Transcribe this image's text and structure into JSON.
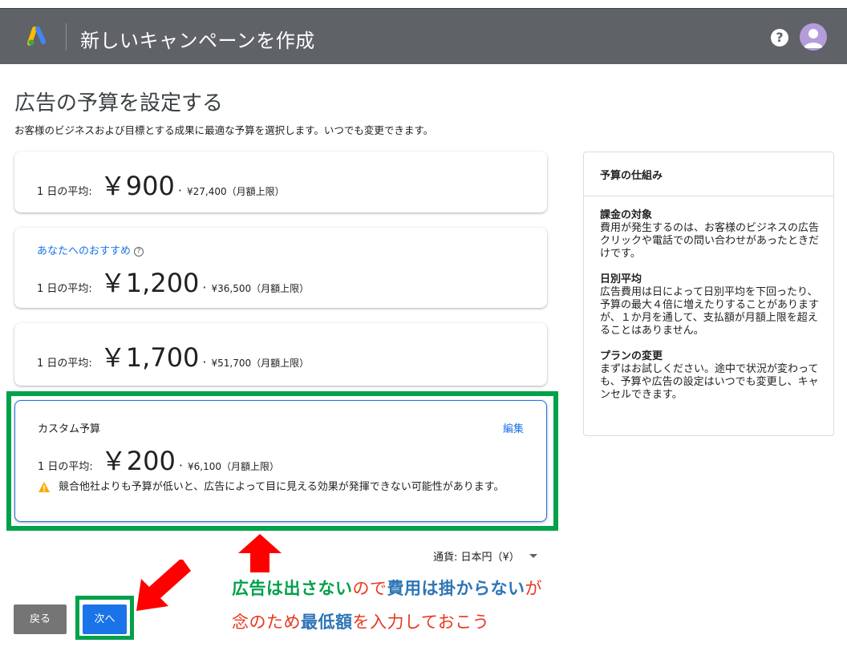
{
  "header": {
    "title": "新しいキャンペーンを作成",
    "help_icon": "?"
  },
  "page": {
    "title": "広告の予算を設定する",
    "description": "お客様のビジネスおよび目標とする成果に最適な予算を選択します。いつでも変更できます。"
  },
  "budget_options": [
    {
      "label": "1 日の平均:",
      "amount": "￥900",
      "monthly": "¥27,400（月額上限）"
    },
    {
      "recommendation": "あなたへのおすすめ",
      "label": "1 日の平均:",
      "amount": "￥1,200",
      "monthly": "¥36,500（月額上限）"
    },
    {
      "label": "1 日の平均:",
      "amount": "￥1,700",
      "monthly": "¥51,700（月額上限）"
    }
  ],
  "custom_budget": {
    "title": "カスタム予算",
    "edit": "編集",
    "label": "1 日の平均:",
    "amount": "￥200",
    "monthly": "¥6,100（月額上限）",
    "warning": "競合他社よりも予算が低いと、広告によって目に見える効果が発揮できない可能性があります。"
  },
  "side_panel": {
    "title": "予算の仕組み",
    "sections": [
      {
        "heading": "課金の対象",
        "body": "費用が発生するのは、お客様のビジネスの広告クリックや電話での問い合わせがあったときだけです。"
      },
      {
        "heading": "日別平均",
        "body": "広告費用は日によって日別平均を下回ったり、予算の最大４倍に増えたりすることがありますが、１か月を通して、支払額が月額上限を超えることはありません。"
      },
      {
        "heading": "プランの変更",
        "body": "まずはお試しください。途中で状況が変わっても、予算や広告の設定はいつでも変更し、キャンセルできます。"
      }
    ]
  },
  "currency": {
    "label": "通貨: 日本円（¥）"
  },
  "buttons": {
    "back": "戻る",
    "next": "次へ"
  },
  "annotation": {
    "line1": [
      {
        "text": "広告は出さない",
        "style": "green"
      },
      {
        "text": "ので",
        "style": "red"
      },
      {
        "text": "費用は掛からない",
        "style": "blue"
      },
      {
        "text": "が",
        "style": "red"
      }
    ],
    "line2": [
      {
        "text": "念のため",
        "style": "red"
      },
      {
        "text": "最低額",
        "style": "blue"
      },
      {
        "text": "を入力しておこう",
        "style": "red"
      }
    ]
  },
  "colors": {
    "highlight_green": "#00a14b",
    "arrow_red": "#e8391f",
    "text_blue": "#2e75b6",
    "link_blue": "#1a73e8",
    "header_gray": "#5f6368"
  }
}
